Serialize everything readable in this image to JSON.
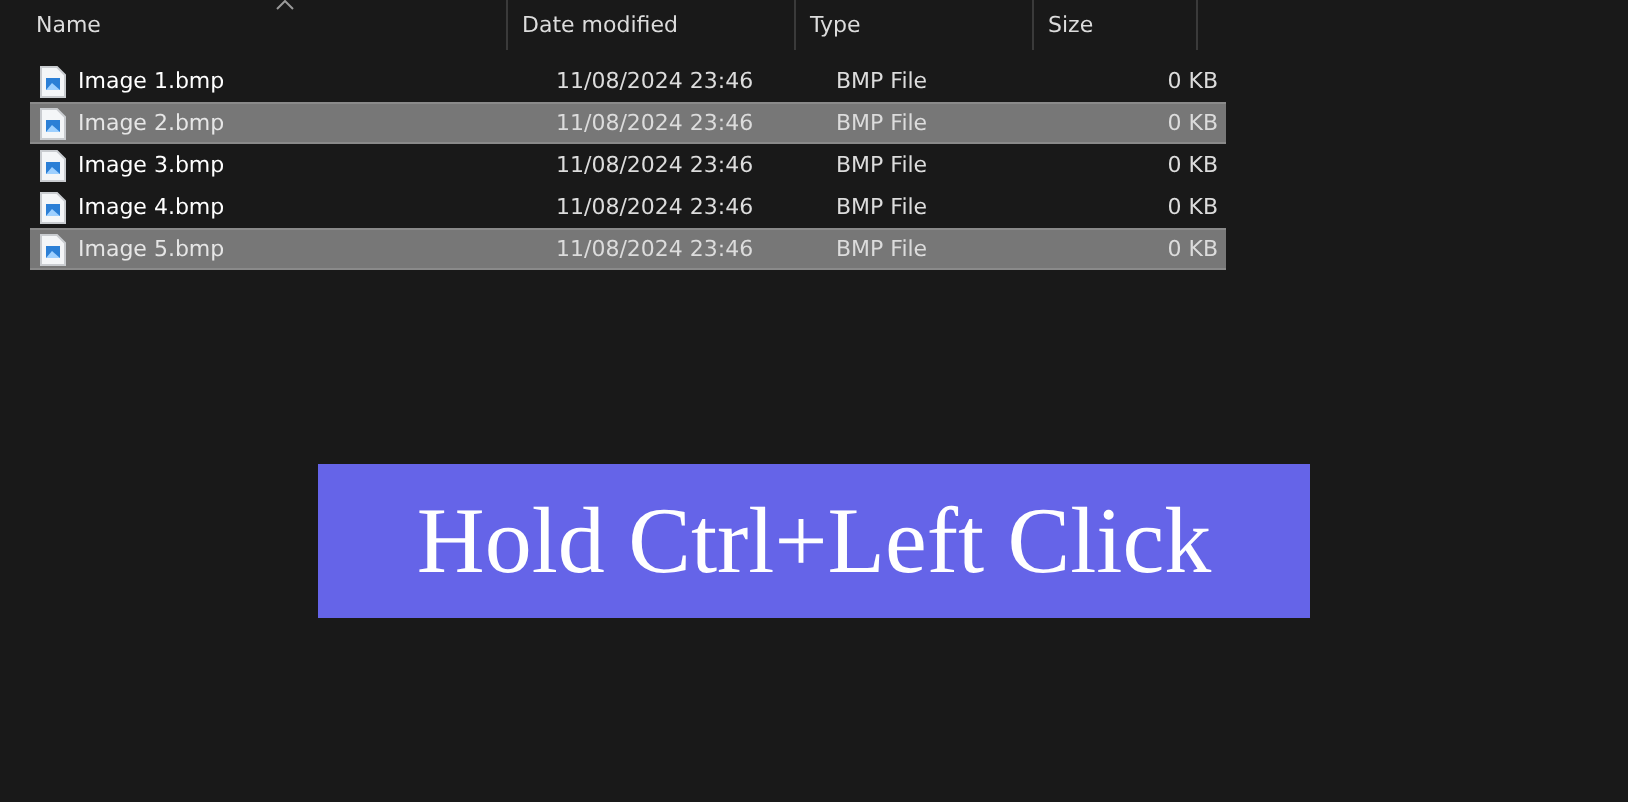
{
  "table": {
    "columns": [
      {
        "label": "Name",
        "sorted": true
      },
      {
        "label": "Date modified",
        "sorted": false
      },
      {
        "label": "Type",
        "sorted": false
      },
      {
        "label": "Size",
        "sorted": false
      }
    ],
    "rows": [
      {
        "name": "Image 1.bmp",
        "date": "11/08/2024 23:46",
        "type": "BMP File",
        "size": "0 KB",
        "selected": false
      },
      {
        "name": "Image 2.bmp",
        "date": "11/08/2024 23:46",
        "type": "BMP File",
        "size": "0 KB",
        "selected": true
      },
      {
        "name": "Image 3.bmp",
        "date": "11/08/2024 23:46",
        "type": "BMP File",
        "size": "0 KB",
        "selected": false
      },
      {
        "name": "Image 4.bmp",
        "date": "11/08/2024 23:46",
        "type": "BMP File",
        "size": "0 KB",
        "selected": false
      },
      {
        "name": "Image 5.bmp",
        "date": "11/08/2024 23:46",
        "type": "BMP File",
        "size": "0 KB",
        "selected": true
      }
    ]
  },
  "caption": "Hold Ctrl+Left Click"
}
